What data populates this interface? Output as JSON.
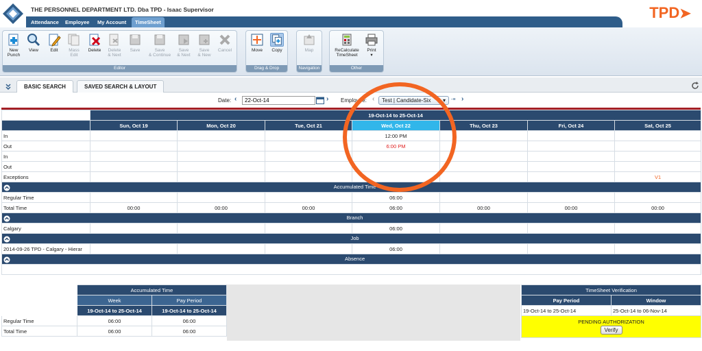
{
  "header": {
    "company": "THE PERSONNEL DEPARTMENT LTD. Dba TPD - Isaac Supervisor",
    "brand": "TPD",
    "brand_color": "#f26522",
    "nav": [
      "Attendance",
      "Employee",
      "My Account",
      "TimeSheet"
    ],
    "nav_active": "TimeSheet"
  },
  "toolbar": {
    "editor": [
      {
        "label": "New\nPunch",
        "icon": "new-punch-icon",
        "enabled": true
      },
      {
        "label": "View",
        "icon": "view-icon",
        "enabled": true
      },
      {
        "label": "Edit",
        "icon": "edit-icon",
        "enabled": true
      },
      {
        "label": "Mass\nEdit",
        "icon": "mass-edit-icon",
        "enabled": false
      },
      {
        "label": "Delete",
        "icon": "delete-icon",
        "enabled": true
      },
      {
        "label": "Delete\n& Next",
        "icon": "delete-next-icon",
        "enabled": false
      },
      {
        "label": "Save",
        "icon": "save-icon",
        "enabled": false
      },
      {
        "label": "Save\n& Continue",
        "icon": "save-continue-icon",
        "enabled": false
      },
      {
        "label": "Save\n& Next",
        "icon": "save-next-icon",
        "enabled": false
      },
      {
        "label": "Save\n& New",
        "icon": "save-new-icon",
        "enabled": false
      },
      {
        "label": "Cancel",
        "icon": "cancel-icon",
        "enabled": false
      }
    ],
    "editor_group": "Editor",
    "dragdrop": [
      {
        "label": "Move",
        "icon": "move-icon"
      },
      {
        "label": "Copy",
        "icon": "copy-icon"
      }
    ],
    "dragdrop_group": "Drag & Drop",
    "navigation": [
      {
        "label": "Map",
        "icon": "map-icon"
      }
    ],
    "navigation_group": "Navigation",
    "other": [
      {
        "label": "ReCalculate\nTimeSheet",
        "icon": "recalculate-icon"
      },
      {
        "label": "Print",
        "icon": "print-icon"
      }
    ],
    "other_group": "Other"
  },
  "tabs": {
    "basic": "BASIC SEARCH",
    "saved": "SAVED SEARCH & LAYOUT"
  },
  "filter": {
    "date_label": "Date:",
    "date_value": "22-Oct-14",
    "employee_label": "Employee:",
    "employee_value": "Test | Candidate-Six"
  },
  "timesheet": {
    "range": "19-Oct-14 to 25-Oct-14",
    "days": [
      "Sun, Oct 19",
      "Mon, Oct 20",
      "Tue, Oct 21",
      "Wed, Oct 22",
      "Thu, Oct 23",
      "Fri, Oct 24",
      "Sat, Oct 25"
    ],
    "highlight_day": 3,
    "punch_rows": [
      {
        "label": "In",
        "values": [
          "",
          "",
          "",
          "12:00 PM",
          "",
          "",
          ""
        ]
      },
      {
        "label": "Out",
        "values": [
          "",
          "",
          "",
          "6:00 PM",
          "",
          "",
          ""
        ]
      },
      {
        "label": "In",
        "values": [
          "",
          "",
          "",
          "",
          "",
          "",
          ""
        ]
      },
      {
        "label": "Out",
        "values": [
          "",
          "",
          "",
          "",
          "",
          "",
          ""
        ]
      },
      {
        "label": "Exceptions",
        "values": [
          "",
          "",
          "",
          "",
          "",
          "",
          "V1"
        ]
      }
    ],
    "accumulated_title": "Accumulated Time",
    "regular_label": "Regular Time",
    "regular_values": [
      "",
      "",
      "",
      "06:00",
      "",
      "",
      ""
    ],
    "total_label": "Total Time",
    "total_values": [
      "00:00",
      "00:00",
      "00:00",
      "06:00",
      "00:00",
      "00:00",
      "00:00"
    ],
    "branch_title": "Branch",
    "branch_label": "Calgary",
    "branch_values": [
      "",
      "",
      "",
      "06:00",
      "",
      "",
      ""
    ],
    "job_title": "Job",
    "job_label": "2014-09-26 TPD - Calgary - Hierar",
    "job_values": [
      "",
      "",
      "",
      "06:00",
      "",
      "",
      ""
    ],
    "absence_title": "Absence"
  },
  "accumulated": {
    "title": "Accumulated Time",
    "col_week": "Week",
    "col_pay": "Pay Period",
    "week_range": "19-Oct-14 to 25-Oct-14",
    "pay_range": "19-Oct-14 to 25-Oct-14",
    "rows": [
      {
        "label": "Regular Time",
        "week": "06:00",
        "pay": "06:00"
      },
      {
        "label": "Total Time",
        "week": "06:00",
        "pay": "06:00"
      }
    ]
  },
  "verification": {
    "title": "TimeSheet Verification",
    "col_pay": "Pay Period",
    "col_window": "Window",
    "pay_value": "19-Oct-14 to 25-Oct-14",
    "window_value": "25-Oct-14 to 06-Nov-14",
    "status": "PENDING AUTHORIZATION",
    "verify": "Verify"
  }
}
